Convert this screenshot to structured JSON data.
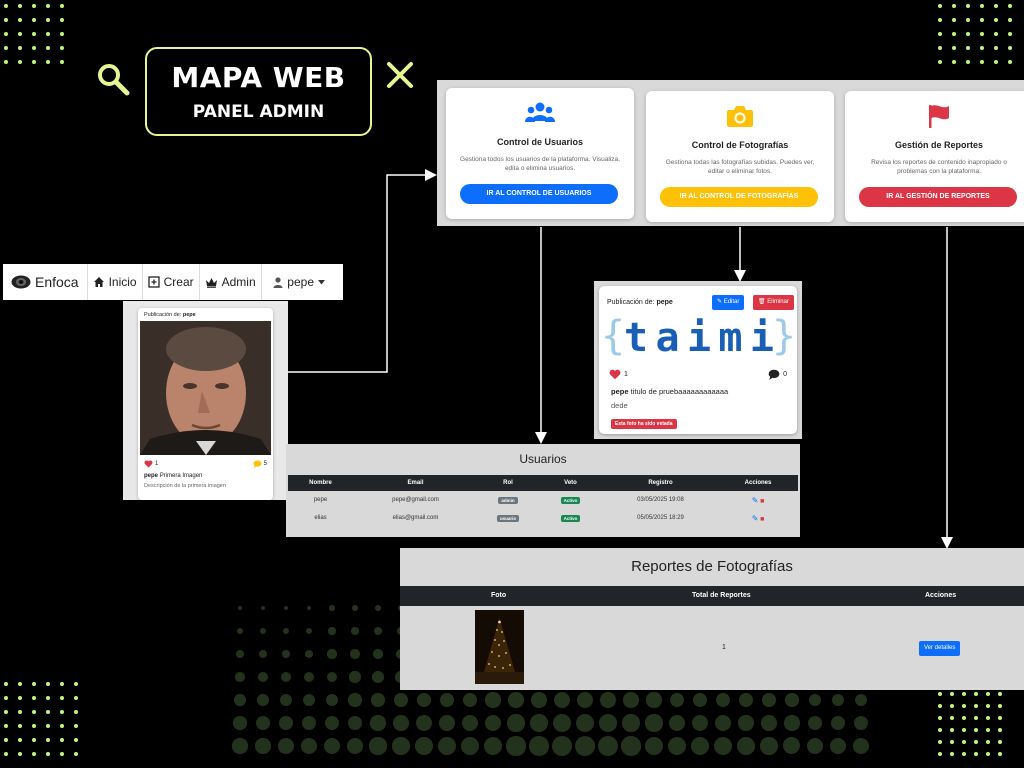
{
  "title": {
    "main": "MAPA WEB",
    "sub": "PANEL ADMIN"
  },
  "navbar": {
    "brand": "Enfoca",
    "items": [
      {
        "label": "Inicio",
        "icon": "home-icon"
      },
      {
        "label": "Crear",
        "icon": "plus-square-icon"
      },
      {
        "label": "Admin",
        "icon": "crown-icon"
      }
    ],
    "user": "pepe"
  },
  "post": {
    "header_prefix": "Publicación de:",
    "author": "pepe",
    "likes": "1",
    "comments": "5",
    "caption_user": "pepe",
    "caption_title": "Primera Imagen",
    "description": "Descripción de la primera imagen"
  },
  "admin": {
    "cards": [
      {
        "icon": "users-icon",
        "title": "Control de Usuarios",
        "desc": "Gestiona todos los usuarios de la plataforma. Visualiza, edita o elimina usuarios.",
        "button": "IR AL CONTROL DE USUARIOS",
        "color": "#0d6efd"
      },
      {
        "icon": "camera-icon",
        "title": "Control de Fotografías",
        "desc": "Gestiona todas las fotografías subidas. Puedes ver, editar o eliminar fotos.",
        "button": "IR AL CONTROL DE FOTOGRAFÍAS",
        "color": "#ffc107"
      },
      {
        "icon": "flag-icon",
        "title": "Gestión de Reportes",
        "desc": "Revisa los reportes de contenido inapropiado o problemas con la plataforma.",
        "button": "IR AL GESTIÓN DE REPORTES",
        "color": "#dc3545"
      }
    ]
  },
  "photo": {
    "header_prefix": "Publicación de:",
    "author": "pepe",
    "edit": "Editar",
    "delete": "Eliminar",
    "image_text": "taimi",
    "likes": "1",
    "comments": "0",
    "caption_user": "pepe",
    "caption_title": "titulo de pruebaaaaaaaaaaaa",
    "description": "dede",
    "vetoed": "Esta foto ha sido vetada"
  },
  "users": {
    "title": "Usuarios",
    "columns": [
      "Nombre",
      "Email",
      "Rol",
      "Veto",
      "Registro",
      "Acciones"
    ],
    "rows": [
      {
        "name": "pepe",
        "email": "pepe@gmail.com",
        "role": "admin",
        "veto": "Activo",
        "date": "03/05/2025 19:08"
      },
      {
        "name": "elias",
        "email": "elias@gmail.com",
        "role": "usuario",
        "veto": "Activo",
        "date": "05/05/2025 18:29"
      }
    ]
  },
  "reports": {
    "title": "Reportes de Fotografías",
    "columns": [
      "Foto",
      "Total de Reportes",
      "Acciones"
    ],
    "rows": [
      {
        "count": "1",
        "button": "Ver detalles"
      }
    ]
  },
  "colors": {
    "accent": "#e6f58f",
    "primary": "#0d6efd",
    "warning": "#ffc107",
    "danger": "#dc3545",
    "success": "#198754"
  }
}
